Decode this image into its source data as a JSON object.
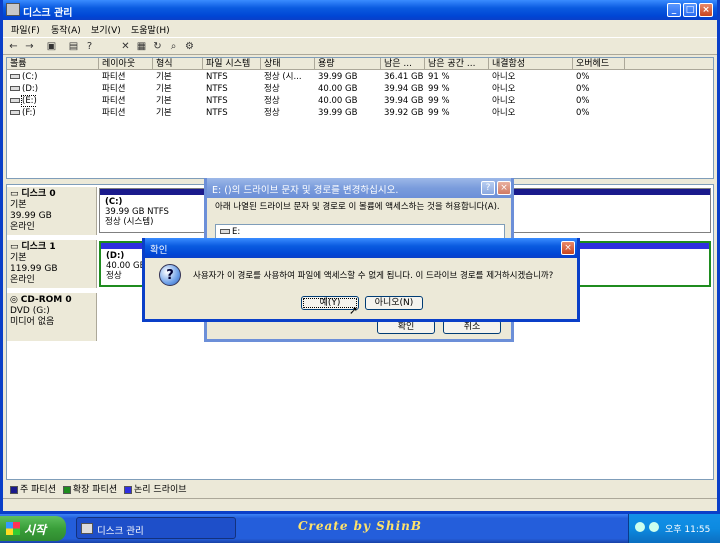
{
  "window": {
    "title": "디스크 관리",
    "minimize": "_",
    "maximize": "□",
    "close": "×"
  },
  "menu": [
    "파일(F)",
    "동작(A)",
    "보기(V)",
    "도움말(H)"
  ],
  "toolbar_icons": [
    "back-icon",
    "forward-icon",
    "console-icon",
    "properties-icon",
    "help-icon",
    "delete-icon",
    "export-icon",
    "refresh-icon",
    "search-icon",
    "settings-icon"
  ],
  "volume_list": {
    "columns": [
      "볼륨",
      "레이아웃",
      "형식",
      "파일 시스템",
      "상태",
      "용량",
      "남은 ...",
      "남은 공간 ...",
      "내결함성",
      "오버헤드"
    ],
    "rows": [
      [
        "(C:)",
        "파티션",
        "기본",
        "NTFS",
        "정상 (시...",
        "39.99 GB",
        "36.41 GB",
        "91 %",
        "아니오",
        "0%"
      ],
      [
        "(D:)",
        "파티션",
        "기본",
        "NTFS",
        "정상",
        "40.00 GB",
        "39.94 GB",
        "99 %",
        "아니오",
        "0%"
      ],
      [
        "(E:)",
        "파티션",
        "기본",
        "NTFS",
        "정상",
        "40.00 GB",
        "39.94 GB",
        "99 %",
        "아니오",
        "0%"
      ],
      [
        "(F:)",
        "파티션",
        "기본",
        "NTFS",
        "정상",
        "39.99 GB",
        "39.92 GB",
        "99 %",
        "아니오",
        "0%"
      ]
    ]
  },
  "disks": [
    {
      "title": "디스크 0",
      "type": "기본",
      "size": "39.99 GB",
      "status": "온라인",
      "partition": {
        "name": "(C:)",
        "line1": "39.99 GB NTFS",
        "line2": "정상 (시스템)"
      }
    },
    {
      "title": "디스크 1",
      "type": "기본",
      "size": "119.99 GB",
      "status": "온라인",
      "partition": {
        "name": "(D:)",
        "line1": "40.00 GB N",
        "line2": "정상"
      }
    },
    {
      "title": "CD-ROM 0",
      "type": "DVD (G:)",
      "size": "",
      "status": "미디어 없음"
    }
  ],
  "legend": [
    {
      "label": "주 파티션",
      "color": "#1a1a8c"
    },
    {
      "label": "확장 파티션",
      "color": "#1f8c1f"
    },
    {
      "label": "논리 드라이브",
      "color": "#2f2fe0"
    }
  ],
  "path_dialog": {
    "title": "E: ()의 드라이브 문자 및 경로를 변경하십시오.",
    "help": "?",
    "close": "×",
    "description": "아래 나열된 드라이브 문자 및 경로로 이 볼륨에 액세스하는 것을 허용합니다(A).",
    "list_item": "E:",
    "ok": "확인",
    "cancel": "취소"
  },
  "confirm_dialog": {
    "title": "확인",
    "close": "×",
    "message": "사용자가 이 경로를 사용하여 파일에 액세스할 수 없게 됩니다. 이 드라이브 경로를 제거하시겠습니까?",
    "yes": "예(Y)",
    "no": "아니오(N)"
  },
  "taskbar": {
    "start": "시작",
    "task": "디스크 관리",
    "signature": "Create by ShinB",
    "clock": "오후 11:55"
  }
}
